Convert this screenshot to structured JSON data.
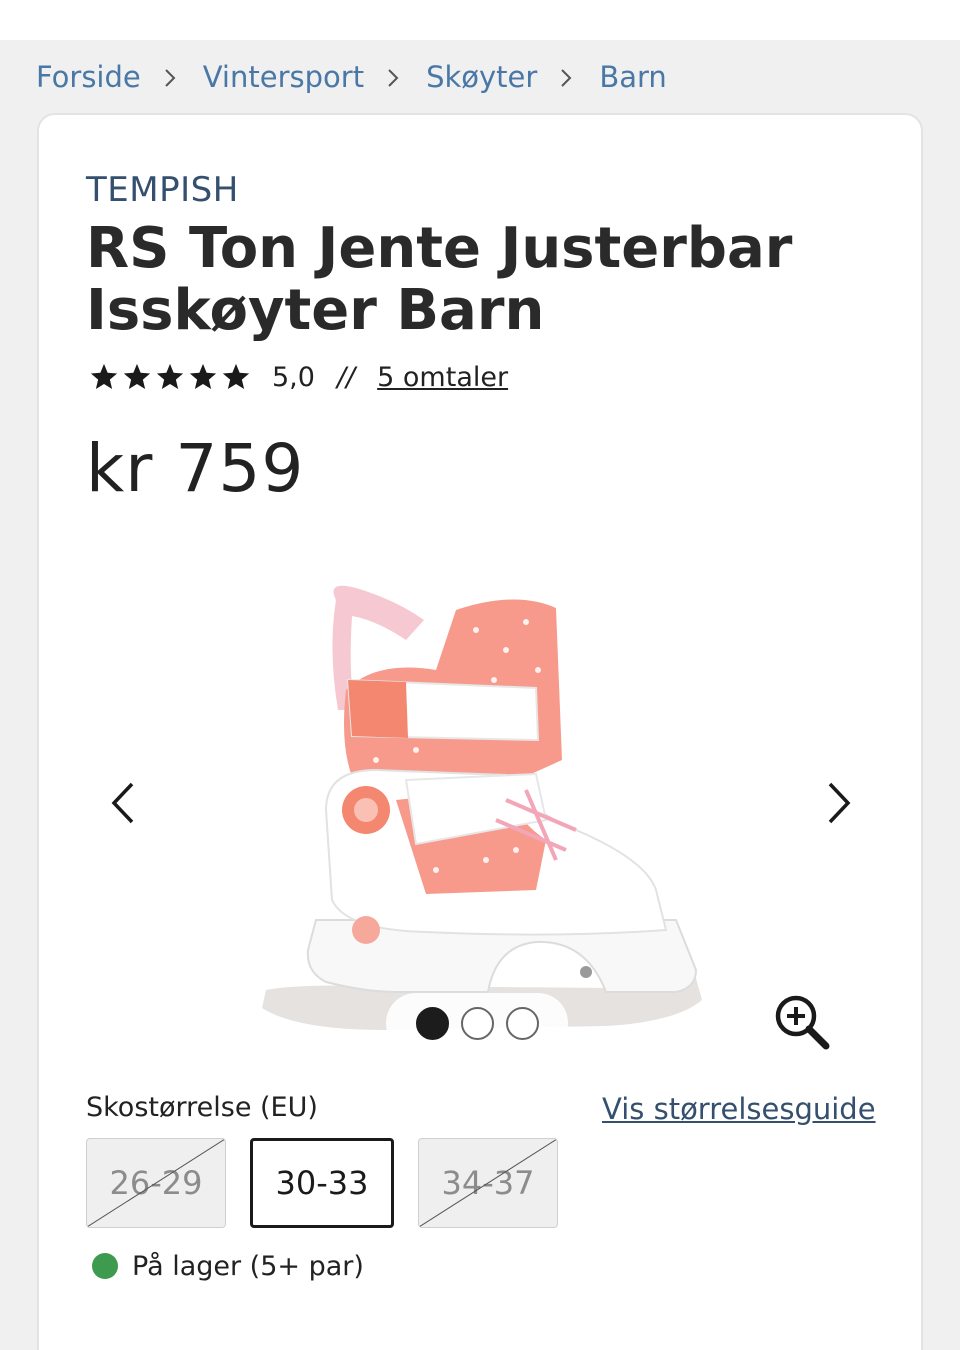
{
  "breadcrumb": {
    "items": [
      {
        "label": "Forside"
      },
      {
        "label": "Vintersport"
      },
      {
        "label": "Skøyter"
      },
      {
        "label": "Barn"
      }
    ]
  },
  "product": {
    "brand": "TEMPISH",
    "title": "RS Ton Jente Justerbar Isskøyter Barn",
    "rating": {
      "stars": 5,
      "value": "5,0",
      "separator": "//",
      "reviews_label": "5 omtaler"
    },
    "price": "kr 759"
  },
  "gallery": {
    "image_icon": "ice-skate-image",
    "current_slide": 1,
    "total_slides": 3,
    "prev_icon": "chevron-left-icon",
    "next_icon": "chevron-right-icon",
    "zoom_icon": "zoom-in-icon"
  },
  "size_selector": {
    "label": "Skostørrelse (EU)",
    "guide_link": "Vis størrelsesguide",
    "options": [
      {
        "label": "26-29",
        "available": false,
        "selected": false
      },
      {
        "label": "30-33",
        "available": true,
        "selected": true
      },
      {
        "label": "34-37",
        "available": false,
        "selected": false
      }
    ]
  },
  "stock": {
    "label": "På lager (5+ par)",
    "status_color": "#3d9a4f"
  },
  "colors": {
    "link": "#4a78a6",
    "brand": "#34506e",
    "accent_pink": "#f2857b"
  }
}
